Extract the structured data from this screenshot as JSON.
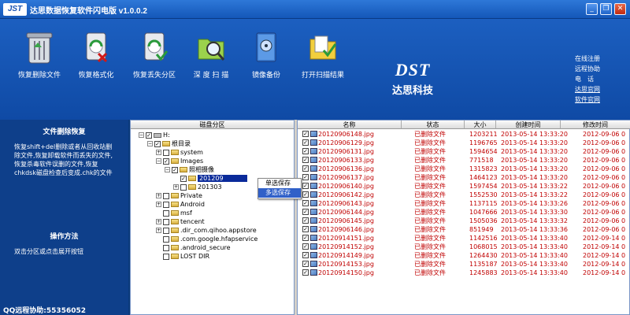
{
  "window": {
    "logo": "JST",
    "title": "达思数据恢复软件闪电版 v1.0.0.2",
    "minimize": "_",
    "restore": "❐",
    "close": "✕"
  },
  "toolbar": {
    "items": [
      {
        "label": "恢复删除文件",
        "icon": "trash-bin-icon"
      },
      {
        "label": "恢复格式化",
        "icon": "formatted-disk-icon"
      },
      {
        "label": "恢复丢失分区",
        "icon": "partition-disk-icon"
      },
      {
        "label": "深 度 扫 描",
        "icon": "folder-magnifier-icon"
      },
      {
        "label": "镜像备份",
        "icon": "disk-image-icon"
      },
      {
        "label": "打开扫描结果",
        "icon": "open-folder-icon"
      }
    ]
  },
  "brand": {
    "logo": "DST",
    "name": "达思科技"
  },
  "links": {
    "register": "在线注册",
    "remote": "远程协助",
    "phone": "电　话",
    "site": "达思官网",
    "software": "软件官网"
  },
  "sidebar": {
    "heading1": "文件删除恢复",
    "description": "恢复shift+del删除或者从回收站删除文件,恢复卸载软件而丢失的文件,恢复杀毒软件误删的文件,恢复chkdsk磁盘检查后变成.chk的文件",
    "heading2": "操作方法",
    "instruction": "双击分区或点击展开按钮",
    "qq": "QQ远程协助:55356052"
  },
  "tree": {
    "header": "磁盘分区",
    "rows": [
      {
        "label": "H:",
        "depth": 0,
        "exp": "−",
        "type": "drive",
        "checked": "✓"
      },
      {
        "label": "根目录",
        "depth": 1,
        "exp": "−",
        "type": "folder",
        "checked": "✓"
      },
      {
        "label": "system",
        "depth": 2,
        "exp": "+",
        "type": "folder",
        "checked": ""
      },
      {
        "label": "Images",
        "depth": 2,
        "exp": "−",
        "type": "folder",
        "checked": "✓"
      },
      {
        "label": "照相摄像",
        "depth": 3,
        "exp": "−",
        "type": "folder",
        "checked": "✓"
      },
      {
        "label": "201209",
        "depth": 4,
        "exp": "",
        "type": "folder",
        "checked": "✓",
        "selected": true
      },
      {
        "label": "201303",
        "depth": 4,
        "exp": "+",
        "type": "folder",
        "checked": ""
      },
      {
        "label": "Private",
        "depth": 2,
        "exp": "+",
        "type": "folder",
        "checked": ""
      },
      {
        "label": "Android",
        "depth": 2,
        "exp": "+",
        "type": "folder",
        "checked": ""
      },
      {
        "label": "msf",
        "depth": 2,
        "exp": "",
        "type": "folder",
        "checked": ""
      },
      {
        "label": "tencent",
        "depth": 2,
        "exp": "+",
        "type": "folder",
        "checked": ""
      },
      {
        "label": ".dir_com.qihoo.appstore",
        "depth": 2,
        "exp": "+",
        "type": "folder",
        "checked": ""
      },
      {
        "label": ".com.google.hfapservice",
        "depth": 2,
        "exp": "",
        "type": "folder",
        "checked": ""
      },
      {
        "label": ".android_secure",
        "depth": 2,
        "exp": "",
        "type": "folder",
        "checked": ""
      },
      {
        "label": "LOST  DIR",
        "depth": 2,
        "exp": "",
        "type": "folder",
        "checked": ""
      }
    ]
  },
  "context_menu": {
    "single": "单选保存",
    "multi": "多选保存"
  },
  "list": {
    "columns": [
      "名称",
      "状态",
      "大小",
      "创建时间",
      "修改时间"
    ],
    "rows": [
      {
        "name": "20120906148.jpg",
        "status": "已删除文件",
        "size": "1203211",
        "created": "2013-05-14 13:33:20",
        "modified": "2012-09-06 0"
      },
      {
        "name": "20120906129.jpg",
        "status": "已删除文件",
        "size": "1196765",
        "created": "2013-05-14 13:33:20",
        "modified": "2012-09-06 0"
      },
      {
        "name": "20120906131.jpg",
        "status": "已删除文件",
        "size": "1594654",
        "created": "2013-05-14 13:33:20",
        "modified": "2012-09-06 0"
      },
      {
        "name": "20120906133.jpg",
        "status": "已删除文件",
        "size": "771518",
        "created": "2013-05-14 13:33:20",
        "modified": "2012-09-06 0"
      },
      {
        "name": "20120906136.jpg",
        "status": "已删除文件",
        "size": "1315823",
        "created": "2013-05-14 13:33:20",
        "modified": "2012-09-06 0"
      },
      {
        "name": "20120906137.jpg",
        "status": "已删除文件",
        "size": "1464123",
        "created": "2013-05-14 13:33:20",
        "modified": "2012-09-06 0"
      },
      {
        "name": "20120906140.jpg",
        "status": "已删除文件",
        "size": "1597454",
        "created": "2013-05-14 13:33:22",
        "modified": "2012-09-06 0"
      },
      {
        "name": "20120906142.jpg",
        "status": "已删除文件",
        "size": "1552530",
        "created": "2013-05-14 13:33:22",
        "modified": "2012-09-06 0"
      },
      {
        "name": "20120906143.jpg",
        "status": "已删除文件",
        "size": "1137115",
        "created": "2013-05-14 13:33:26",
        "modified": "2012-09-06 0"
      },
      {
        "name": "20120906144.jpg",
        "status": "已删除文件",
        "size": "1047666",
        "created": "2013-05-14 13:33:30",
        "modified": "2012-09-06 0"
      },
      {
        "name": "20120906145.jpg",
        "status": "已删除文件",
        "size": "1505036",
        "created": "2013-05-14 13:33:32",
        "modified": "2012-09-06 0"
      },
      {
        "name": "20120906146.jpg",
        "status": "已删除文件",
        "size": "851949",
        "created": "2013-05-14 13:33:36",
        "modified": "2012-09-06 0"
      },
      {
        "name": "20120914151.jpg",
        "status": "已删除文件",
        "size": "1142516",
        "created": "2013-05-14 13:33:40",
        "modified": "2012-09-14 0"
      },
      {
        "name": "20120914152.jpg",
        "status": "已删除文件",
        "size": "1068015",
        "created": "2013-05-14 13:33:40",
        "modified": "2012-09-14 0"
      },
      {
        "name": "20120914149.jpg",
        "status": "已删除文件",
        "size": "1264430",
        "created": "2013-05-14 13:33:40",
        "modified": "2012-09-14 0"
      },
      {
        "name": "20120914153.jpg",
        "status": "已删除文件",
        "size": "1135187",
        "created": "2013-05-14 13:33:40",
        "modified": "2012-09-14 0"
      },
      {
        "name": "20120914150.jpg",
        "status": "已删除文件",
        "size": "1245883",
        "created": "2013-05-14 13:33:40",
        "modified": "2012-09-14 0"
      }
    ]
  }
}
